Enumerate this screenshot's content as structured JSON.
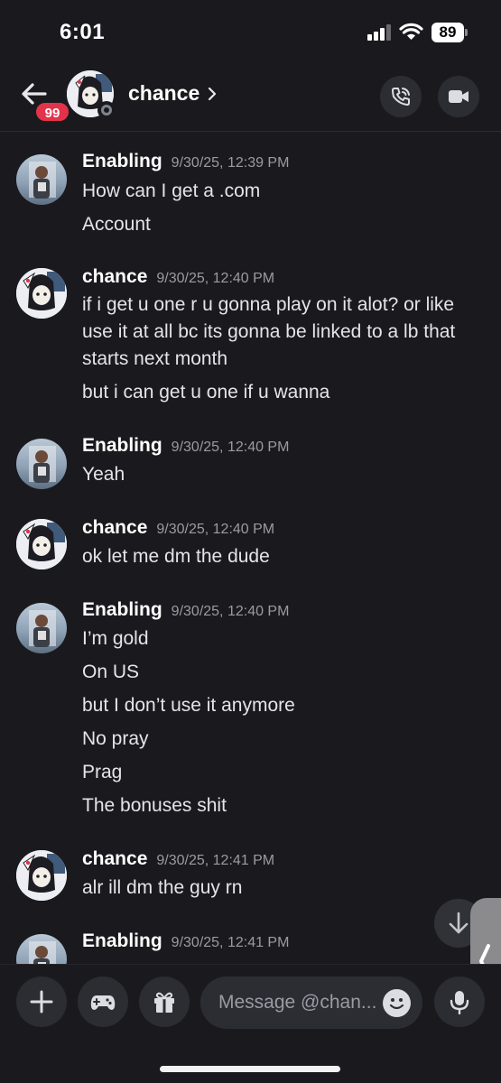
{
  "status_bar": {
    "time": "6:01",
    "battery": "89"
  },
  "header": {
    "badge": "99",
    "name": "chance"
  },
  "messages": [
    {
      "author": "Enabling",
      "timestamp": "9/30/25, 12:39 PM",
      "lines": [
        "How can I get a .com",
        "Account"
      ]
    },
    {
      "author": "chance",
      "timestamp": "9/30/25, 12:40 PM",
      "lines": [
        "if i get u one r u gonna play on it alot? or like",
        "use it at all bc its gonna be linked to a lb that",
        "starts next month",
        "but i can get u one if u wanna"
      ]
    },
    {
      "author": "Enabling",
      "timestamp": "9/30/25, 12:40 PM",
      "lines": [
        "Yeah"
      ]
    },
    {
      "author": "chance",
      "timestamp": "9/30/25, 12:40 PM",
      "lines": [
        "ok let me dm the dude"
      ]
    },
    {
      "author": "Enabling",
      "timestamp": "9/30/25, 12:40 PM",
      "lines": [
        "I’m gold",
        "On US",
        "but I don’t use it anymore",
        "No pray",
        "Prag",
        "The bonuses shit"
      ]
    },
    {
      "author": "chance",
      "timestamp": "9/30/25, 12:41 PM",
      "lines": [
        "alr ill dm the guy rn"
      ]
    },
    {
      "author": "Enabling",
      "timestamp": "9/30/25, 12:41 PM",
      "lines": []
    }
  ],
  "composer": {
    "placeholder": "Message @chan..."
  },
  "icons": {
    "back": "back-arrow-icon",
    "call": "phone-icon",
    "video": "video-camera-icon",
    "scroll": "arrow-down-icon",
    "add": "plus-icon",
    "games": "gamepad-icon",
    "gift": "gift-icon",
    "emoji": "emoji-icon",
    "mic": "microphone-icon"
  },
  "colors": {
    "background": "#1a1a1e",
    "badge": "#e2334a",
    "button": "#2b2d33",
    "timestamp": "#9a9ba3"
  }
}
